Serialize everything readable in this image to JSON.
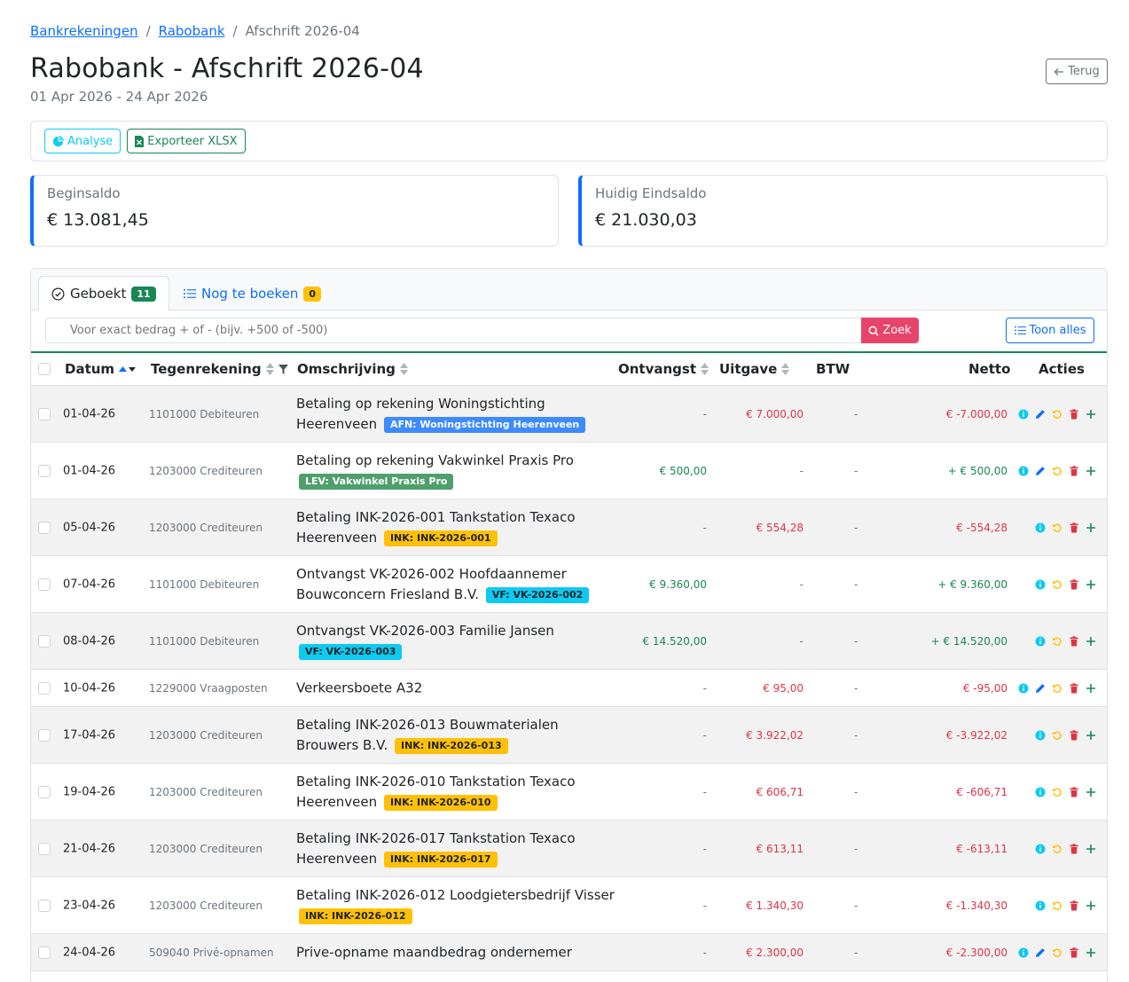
{
  "breadcrumb": {
    "items": [
      "Bankrekeningen",
      "Rabobank"
    ],
    "separator": "/",
    "current": "Afschrift 2026-04"
  },
  "header": {
    "title": "Rabobank - Afschrift 2026-04",
    "period": "01 Apr 2026 - 24 Apr 2026",
    "back_label": "Terug"
  },
  "toolbar": {
    "analyse_label": "Analyse",
    "export_label": "Exporteer XLSX"
  },
  "saldo": {
    "begin_label": "Beginsaldo",
    "begin_value": "€ 13.081,45",
    "end_label": "Huidig Eindsaldo",
    "end_value": "€ 21.030,03"
  },
  "tabs": [
    {
      "label": "Geboekt",
      "count": "11",
      "icon": "check-circle-icon"
    },
    {
      "label": "Nog te boeken",
      "count": "0",
      "icon": "list-icon"
    }
  ],
  "search": {
    "placeholder": "Voor exact bedrag + of - (bijv. +500 of -500)",
    "button_label": "Zoek",
    "show_all_label": "Toon alles"
  },
  "table": {
    "headers": {
      "datum": "Datum",
      "tegenrekening": "Tegenrekening",
      "omschrijving": "Omschrijving",
      "ontvangst": "Ontvangst",
      "uitgave": "Uitgave",
      "btw": "BTW",
      "netto": "Netto",
      "acties": "Acties"
    },
    "rows": [
      {
        "date": "01-04-26",
        "acc_num": "1101000",
        "acc_name": "Debiteuren",
        "desc": "Betaling op rekening Woningstichting Heerenveen",
        "tag": "AFN: Woningstichting Heerenveen",
        "tag_color": "blue",
        "in": "-",
        "out": "€ 7.000,00",
        "btw": "-",
        "net": "€ -7.000,00",
        "net_sign": "neg",
        "editable": true
      },
      {
        "date": "01-04-26",
        "acc_num": "1203000",
        "acc_name": "Crediteuren",
        "desc": "Betaling op rekening Vakwinkel Praxis Pro",
        "tag": "LEV: Vakwinkel Praxis Pro",
        "tag_color": "green",
        "in": "€ 500,00",
        "out": "-",
        "btw": "-",
        "net": "+ € 500,00",
        "net_sign": "pos",
        "editable": true
      },
      {
        "date": "05-04-26",
        "acc_num": "1203000",
        "acc_name": "Crediteuren",
        "desc": "Betaling INK-2026-001 Tankstation Texaco Heerenveen",
        "tag": "INK: INK-2026-001",
        "tag_color": "yellow",
        "in": "-",
        "out": "€ 554,28",
        "btw": "-",
        "net": "€ -554,28",
        "net_sign": "neg",
        "editable": false
      },
      {
        "date": "07-04-26",
        "acc_num": "1101000",
        "acc_name": "Debiteuren",
        "desc": "Ontvangst VK-2026-002 Hoofdaannemer Bouwconcern Friesland B.V.",
        "tag": "VF: VK-2026-002",
        "tag_color": "cyan",
        "in": "€ 9.360,00",
        "out": "-",
        "btw": "-",
        "net": "+ € 9.360,00",
        "net_sign": "pos",
        "editable": false
      },
      {
        "date": "08-04-26",
        "acc_num": "1101000",
        "acc_name": "Debiteuren",
        "desc": "Ontvangst VK-2026-003 Familie Jansen",
        "tag": "VF: VK-2026-003",
        "tag_color": "cyan",
        "in": "€ 14.520,00",
        "out": "-",
        "btw": "-",
        "net": "+ € 14.520,00",
        "net_sign": "pos",
        "editable": false
      },
      {
        "date": "10-04-26",
        "acc_num": "1229000",
        "acc_name": "Vraagposten",
        "desc": "Verkeersboete A32",
        "tag": "",
        "tag_color": "",
        "in": "-",
        "out": "€ 95,00",
        "btw": "-",
        "net": "€ -95,00",
        "net_sign": "neg",
        "editable": true
      },
      {
        "date": "17-04-26",
        "acc_num": "1203000",
        "acc_name": "Crediteuren",
        "desc": "Betaling INK-2026-013 Bouwmaterialen Brouwers B.V.",
        "tag": "INK: INK-2026-013",
        "tag_color": "yellow",
        "in": "-",
        "out": "€ 3.922,02",
        "btw": "-",
        "net": "€ -3.922,02",
        "net_sign": "neg",
        "editable": false
      },
      {
        "date": "19-04-26",
        "acc_num": "1203000",
        "acc_name": "Crediteuren",
        "desc": "Betaling INK-2026-010 Tankstation Texaco Heerenveen",
        "tag": "INK: INK-2026-010",
        "tag_color": "yellow",
        "in": "-",
        "out": "€ 606,71",
        "btw": "-",
        "net": "€ -606,71",
        "net_sign": "neg",
        "editable": false
      },
      {
        "date": "21-04-26",
        "acc_num": "1203000",
        "acc_name": "Crediteuren",
        "desc": "Betaling INK-2026-017 Tankstation Texaco Heerenveen",
        "tag": "INK: INK-2026-017",
        "tag_color": "yellow",
        "in": "-",
        "out": "€ 613,11",
        "btw": "-",
        "net": "€ -613,11",
        "net_sign": "neg",
        "editable": false
      },
      {
        "date": "23-04-26",
        "acc_num": "1203000",
        "acc_name": "Crediteuren",
        "desc": "Betaling INK-2026-012 Loodgietersbedrijf Visser",
        "tag": "INK: INK-2026-012",
        "tag_color": "yellow",
        "in": "-",
        "out": "€ 1.340,30",
        "btw": "-",
        "net": "€ -1.340,30",
        "net_sign": "neg",
        "editable": false
      },
      {
        "date": "24-04-26",
        "acc_num": "509040",
        "acc_name": "Privé-opnamen",
        "desc": "Prive-opname maandbedrag ondernemer",
        "tag": "",
        "tag_color": "",
        "in": "-",
        "out": "€ 2.300,00",
        "btw": "-",
        "net": "€ -2.300,00",
        "net_sign": "neg",
        "editable": true
      }
    ]
  },
  "colors": {
    "primary": "#0d6efd",
    "success": "#198754",
    "danger": "#dc3545",
    "warning": "#ffc107",
    "info": "#0dcaf0",
    "search_button": "#e8436a"
  }
}
